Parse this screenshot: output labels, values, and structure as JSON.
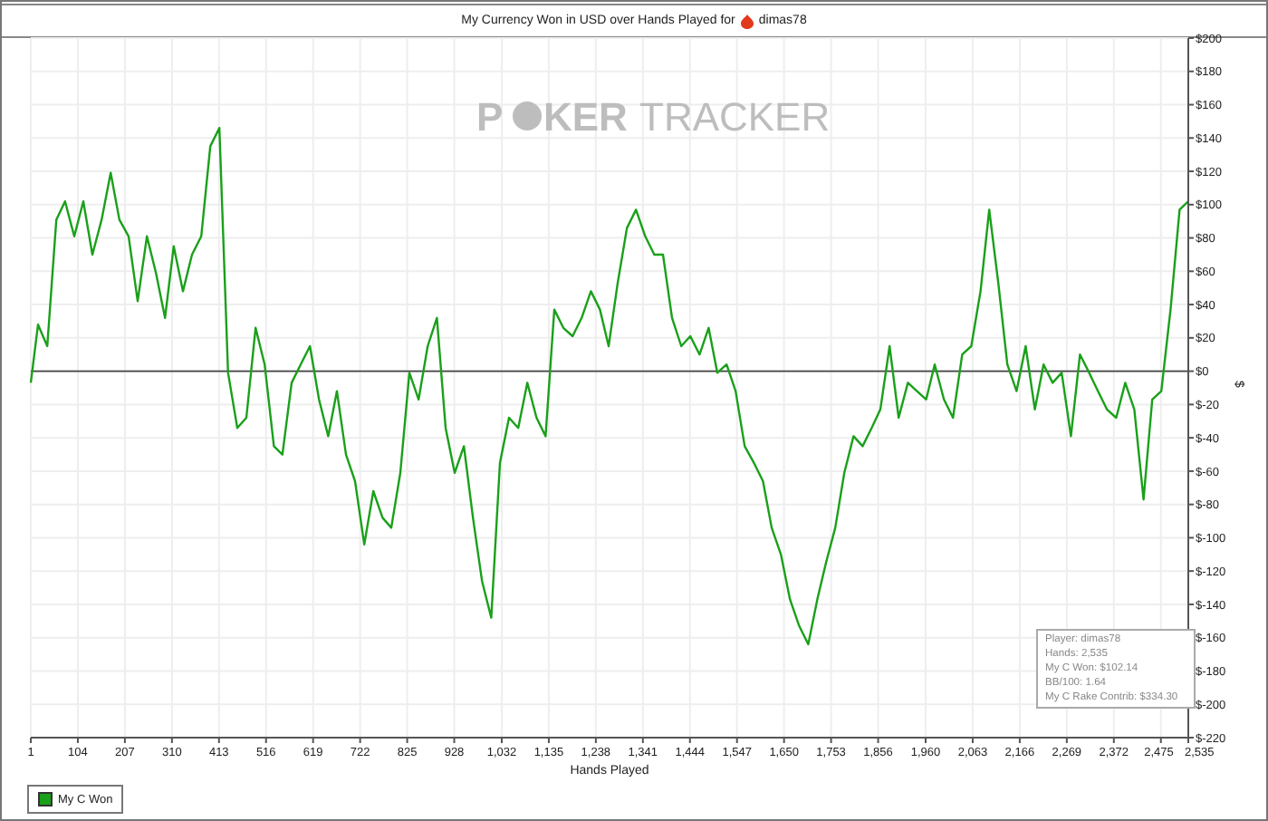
{
  "title": {
    "text": "My Currency Won in USD over Hands Played for",
    "player": "dimas78"
  },
  "logo": {
    "parts": [
      "P",
      "KER",
      "TRACKER"
    ]
  },
  "chart_data": {
    "type": "line",
    "grid": true,
    "xlabel": "Hands Played",
    "ylabel": "$",
    "xlim": [
      1,
      2535
    ],
    "ylim": [
      -220,
      200
    ],
    "x": [
      1,
      17,
      37,
      57,
      76,
      96,
      116,
      136,
      156,
      176,
      195,
      215,
      235,
      255,
      275,
      295,
      314,
      334,
      354,
      374,
      394,
      414,
      433,
      453,
      473,
      493,
      513,
      533,
      552,
      572,
      592,
      612,
      632,
      652,
      671,
      691,
      711,
      731,
      751,
      771,
      790,
      810,
      830,
      850,
      870,
      890,
      909,
      929,
      949,
      969,
      989,
      1009,
      1028,
      1048,
      1068,
      1088,
      1108,
      1128,
      1147,
      1167,
      1187,
      1207,
      1227,
      1247,
      1266,
      1286,
      1306,
      1326,
      1346,
      1366,
      1385,
      1405,
      1425,
      1445,
      1465,
      1485,
      1504,
      1524,
      1544,
      1564,
      1584,
      1604,
      1623,
      1643,
      1663,
      1683,
      1703,
      1723,
      1742,
      1762,
      1782,
      1802,
      1822,
      1842,
      1861,
      1881,
      1901,
      1921,
      1941,
      1961,
      1980,
      2000,
      2020,
      2040,
      2060,
      2080,
      2099,
      2119,
      2139,
      2159,
      2179,
      2199,
      2218,
      2238,
      2258,
      2278,
      2298,
      2318,
      2337,
      2357,
      2377,
      2397,
      2417,
      2437,
      2456,
      2476,
      2496,
      2516,
      2535
    ],
    "series": [
      {
        "name": "My C Won",
        "color": "#1aa01a",
        "values": [
          -7,
          28,
          15,
          91,
          102,
          81,
          102,
          70,
          91,
          119,
          91,
          81,
          42,
          81,
          59,
          32,
          75,
          48,
          70,
          81,
          135,
          146,
          -1,
          -34,
          -28,
          26,
          4,
          -45,
          -50,
          -7,
          4,
          15,
          -17,
          -39,
          -12,
          -50,
          -66,
          -104,
          -72,
          -88,
          -94,
          -61,
          -1,
          -17,
          15,
          32,
          -34,
          -61,
          -45,
          -88,
          -126,
          -148,
          -55,
          -28,
          -34,
          -7,
          -28,
          -39,
          37,
          26,
          21,
          32,
          48,
          37,
          15,
          53,
          86,
          97,
          81,
          70,
          70,
          32,
          15,
          21,
          10,
          26,
          -1,
          4,
          -12,
          -45,
          -55,
          -66,
          -94,
          -110,
          -137,
          -153,
          -164,
          -137,
          -115,
          -94,
          -61,
          -39,
          -45,
          -34,
          -23,
          15,
          -28,
          -7,
          -12,
          -17,
          4,
          -17,
          -28,
          10,
          15,
          48,
          97,
          53,
          4,
          -12,
          15,
          -23,
          4,
          -7,
          -1,
          -39,
          10,
          -1,
          -12,
          -23,
          -28,
          -7,
          -23,
          -77,
          -17,
          -12,
          37,
          97,
          102
        ]
      }
    ],
    "xticks": [
      1,
      104,
      207,
      310,
      413,
      516,
      619,
      722,
      825,
      928,
      {
        "value": 1032,
        "label": "1,032"
      },
      {
        "value": 1135,
        "label": "1,135"
      },
      {
        "value": 1238,
        "label": "1,238"
      },
      {
        "value": 1341,
        "label": "1,341"
      },
      {
        "value": 1444,
        "label": "1,444"
      },
      {
        "value": 1547,
        "label": "1,547"
      },
      {
        "value": 1650,
        "label": "1,650"
      },
      {
        "value": 1753,
        "label": "1,753"
      },
      {
        "value": 1856,
        "label": "1,856"
      },
      {
        "value": 1960,
        "label": "1,960"
      },
      {
        "value": 2063,
        "label": "2,063"
      },
      {
        "value": 2166,
        "label": "2,166"
      },
      {
        "value": 2269,
        "label": "2,269"
      },
      {
        "value": 2372,
        "label": "2,372"
      },
      {
        "value": 2475,
        "label": "2,475"
      },
      {
        "value": 2535,
        "label": "2,535"
      }
    ],
    "yticks": [
      {
        "value": 200,
        "label": "$200"
      },
      {
        "value": 180,
        "label": "$180"
      },
      {
        "value": 160,
        "label": "$160"
      },
      {
        "value": 140,
        "label": "$140"
      },
      {
        "value": 120,
        "label": "$120"
      },
      {
        "value": 100,
        "label": "$100"
      },
      {
        "value": 80,
        "label": "$80"
      },
      {
        "value": 60,
        "label": "$60"
      },
      {
        "value": 40,
        "label": "$40"
      },
      {
        "value": 20,
        "label": "$20"
      },
      {
        "value": 0,
        "label": "$0"
      },
      {
        "value": -20,
        "label": "$-20"
      },
      {
        "value": -40,
        "label": "$-40"
      },
      {
        "value": -60,
        "label": "$-60"
      },
      {
        "value": -80,
        "label": "$-80"
      },
      {
        "value": -100,
        "label": "$-100"
      },
      {
        "value": -120,
        "label": "$-120"
      },
      {
        "value": -140,
        "label": "$-140"
      },
      {
        "value": -160,
        "label": "$-160"
      },
      {
        "value": -180,
        "label": "$-180"
      },
      {
        "value": -200,
        "label": "$-200"
      },
      {
        "value": -220,
        "label": "$-220"
      }
    ]
  },
  "tooltip": [
    "Player: dimas78",
    "Hands: 2,535",
    "My C Won: $102.14",
    "BB/100: 1.64",
    "My C Rake Contrib: $334.30"
  ]
}
